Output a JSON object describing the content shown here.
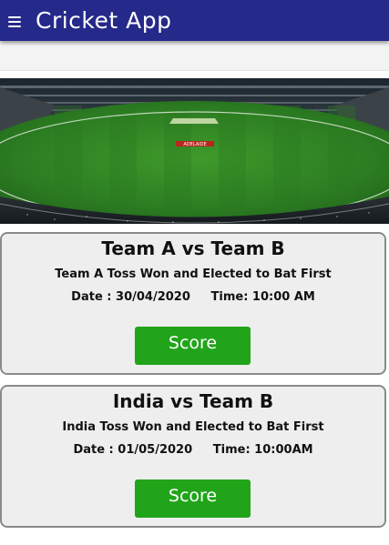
{
  "app": {
    "title": "Cricket App",
    "menu_icon": "hamburger-menu-icon",
    "colors": {
      "appbar": "#25298a",
      "button": "#21a41a",
      "card_background": "#eeeeee",
      "card_border": "#8a8a8a"
    }
  },
  "banner": {
    "image": "cricket-stadium-photo",
    "sign_text": "ADELAIDE"
  },
  "matches": [
    {
      "title": "Team A vs Team B",
      "toss": "Team A Toss Won and Elected to Bat First",
      "schedule": "Date : 30/04/2020     Time: 10:00 AM",
      "button_label": "Score"
    },
    {
      "title": "India vs Team B",
      "toss": "India Toss Won and Elected to Bat First",
      "schedule": "Date : 01/05/2020     Time: 10:00AM",
      "button_label": "Score"
    }
  ]
}
